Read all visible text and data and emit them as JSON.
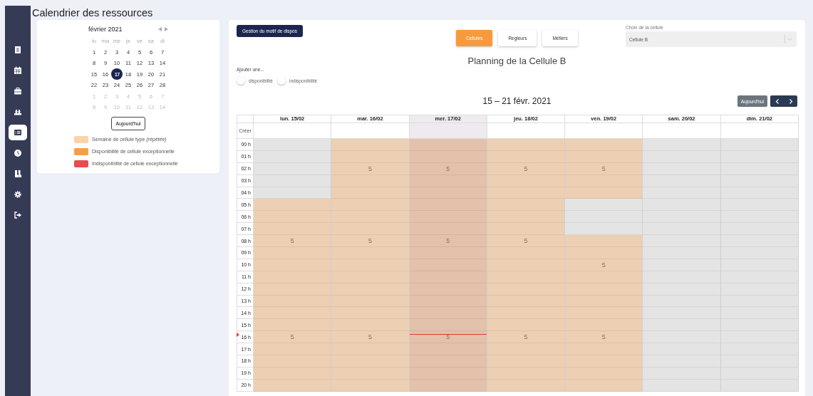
{
  "page_title": "Calendrier des ressources",
  "sidebar": {
    "items": [
      {
        "selected": false
      },
      {
        "selected": false
      },
      {
        "selected": false
      },
      {
        "selected": false
      },
      {
        "selected": true
      },
      {
        "selected": false
      },
      {
        "selected": false
      },
      {
        "selected": false
      },
      {
        "selected": false
      }
    ]
  },
  "mini_calendar": {
    "month": "février 2021",
    "weekdays": [
      "lu",
      "ma",
      "me",
      "je",
      "ve",
      "sa",
      "di"
    ],
    "weeks": [
      [
        {
          "day": "1",
          "outside": false,
          "selected": false
        },
        {
          "day": "2",
          "outside": false,
          "selected": false
        },
        {
          "day": "3",
          "outside": false,
          "selected": false
        },
        {
          "day": "4",
          "outside": false,
          "selected": false
        },
        {
          "day": "5",
          "outside": false,
          "selected": false
        },
        {
          "day": "6",
          "outside": false,
          "selected": false
        },
        {
          "day": "7",
          "outside": false,
          "selected": false
        }
      ],
      [
        {
          "day": "8",
          "outside": false,
          "selected": false
        },
        {
          "day": "9",
          "outside": false,
          "selected": false
        },
        {
          "day": "10",
          "outside": false,
          "selected": false
        },
        {
          "day": "11",
          "outside": false,
          "selected": false
        },
        {
          "day": "12",
          "outside": false,
          "selected": false
        },
        {
          "day": "13",
          "outside": false,
          "selected": false
        },
        {
          "day": "14",
          "outside": false,
          "selected": false
        }
      ],
      [
        {
          "day": "15",
          "outside": false,
          "selected": false
        },
        {
          "day": "16",
          "outside": false,
          "selected": false
        },
        {
          "day": "17",
          "outside": false,
          "selected": true
        },
        {
          "day": "18",
          "outside": false,
          "selected": false
        },
        {
          "day": "19",
          "outside": false,
          "selected": false
        },
        {
          "day": "20",
          "outside": false,
          "selected": false
        },
        {
          "day": "21",
          "outside": false,
          "selected": false
        }
      ],
      [
        {
          "day": "22",
          "outside": false,
          "selected": false
        },
        {
          "day": "23",
          "outside": false,
          "selected": false
        },
        {
          "day": "24",
          "outside": false,
          "selected": false
        },
        {
          "day": "25",
          "outside": false,
          "selected": false
        },
        {
          "day": "26",
          "outside": false,
          "selected": false
        },
        {
          "day": "27",
          "outside": false,
          "selected": false
        },
        {
          "day": "28",
          "outside": false,
          "selected": false
        }
      ],
      [
        {
          "day": "1",
          "outside": true,
          "selected": false
        },
        {
          "day": "2",
          "outside": true,
          "selected": false
        },
        {
          "day": "3",
          "outside": true,
          "selected": false
        },
        {
          "day": "4",
          "outside": true,
          "selected": false
        },
        {
          "day": "5",
          "outside": true,
          "selected": false
        },
        {
          "day": "6",
          "outside": true,
          "selected": false
        },
        {
          "day": "7",
          "outside": true,
          "selected": false
        }
      ],
      [
        {
          "day": "8",
          "outside": true,
          "selected": false
        },
        {
          "day": "9",
          "outside": true,
          "selected": false
        },
        {
          "day": "10",
          "outside": true,
          "selected": false
        },
        {
          "day": "11",
          "outside": true,
          "selected": false
        },
        {
          "day": "12",
          "outside": true,
          "selected": false
        },
        {
          "day": "13",
          "outside": true,
          "selected": false
        },
        {
          "day": "14",
          "outside": true,
          "selected": false
        }
      ]
    ],
    "today_button": "Aujourd'hui"
  },
  "legend": [
    {
      "label": "Semaine de cellule type *(répétée)*",
      "color": "#fdd2a8"
    },
    {
      "label": "Disponibilité de cellule exceptionnelle",
      "color": "#fb9d43"
    },
    {
      "label": "Indisponibilité de cellule exceptionnelle",
      "color": "#e94b4f"
    }
  ],
  "motif_button": "Gestion du motif de dispos",
  "view_tabs": [
    {
      "label": "Cellules",
      "selected": true
    },
    {
      "label": "Regleurs",
      "selected": false
    },
    {
      "label": "Métiers",
      "selected": false
    }
  ],
  "cell_select": {
    "label": "Choix de la cellule",
    "value": "Cellule B"
  },
  "planning_title": "Planning de la Cellule B",
  "add": {
    "label": "Ajouter une...",
    "options": [
      {
        "label": "disponibilité",
        "selected": false
      },
      {
        "label": "indisponibilité",
        "selected": false
      }
    ]
  },
  "range_title": "15 – 21 févr. 2021",
  "today_button": "Aujourd'hui",
  "calendar": {
    "create_label": "Créer",
    "hours": [
      "00 h",
      "01 h",
      "02 h",
      "03 h",
      "04 h",
      "05 h",
      "06 h",
      "07 h",
      "08 h",
      "09 h",
      "10 h",
      "11 h",
      "12 h",
      "13 h",
      "14 h",
      "15 h",
      "16 h",
      "17 h",
      "18 h",
      "19 h",
      "20 h"
    ],
    "days": [
      {
        "label": "lun. 15/02",
        "today": false,
        "slots": [
          {
            "kind": "none"
          },
          {
            "kind": "none"
          },
          {
            "kind": "none"
          },
          {
            "kind": "none"
          },
          {
            "kind": "none"
          },
          {
            "kind": "weekly"
          },
          {
            "kind": "weekly"
          },
          {
            "kind": "weekly"
          },
          {
            "kind": "weekly",
            "label": "5"
          },
          {
            "kind": "weekly"
          },
          {
            "kind": "weekly"
          },
          {
            "kind": "weekly"
          },
          {
            "kind": "weekly"
          },
          {
            "kind": "weekly"
          },
          {
            "kind": "weekly"
          },
          {
            "kind": "weekly"
          },
          {
            "kind": "weekly",
            "label": "5"
          },
          {
            "kind": "weekly"
          },
          {
            "kind": "weekly"
          },
          {
            "kind": "weekly"
          },
          {
            "kind": "weekly"
          }
        ]
      },
      {
        "label": "mar. 16/02",
        "today": false,
        "slots": [
          {
            "kind": "weekly"
          },
          {
            "kind": "weekly"
          },
          {
            "kind": "weekly",
            "label": "5"
          },
          {
            "kind": "weekly"
          },
          {
            "kind": "weekly"
          },
          {
            "kind": "weekly"
          },
          {
            "kind": "weekly"
          },
          {
            "kind": "weekly"
          },
          {
            "kind": "weekly",
            "label": "5"
          },
          {
            "kind": "weekly"
          },
          {
            "kind": "weekly"
          },
          {
            "kind": "weekly"
          },
          {
            "kind": "weekly"
          },
          {
            "kind": "weekly"
          },
          {
            "kind": "weekly"
          },
          {
            "kind": "weekly"
          },
          {
            "kind": "weekly",
            "label": "5"
          },
          {
            "kind": "weekly"
          },
          {
            "kind": "weekly"
          },
          {
            "kind": "weekly"
          },
          {
            "kind": "weekly"
          }
        ]
      },
      {
        "label": "mer. 17/02",
        "today": true,
        "slots": [
          {
            "kind": "weekly"
          },
          {
            "kind": "weekly"
          },
          {
            "kind": "weekly",
            "label": "5"
          },
          {
            "kind": "weekly"
          },
          {
            "kind": "weekly"
          },
          {
            "kind": "weekly"
          },
          {
            "kind": "weekly"
          },
          {
            "kind": "weekly"
          },
          {
            "kind": "weekly",
            "label": "5"
          },
          {
            "kind": "weekly"
          },
          {
            "kind": "weekly"
          },
          {
            "kind": "weekly"
          },
          {
            "kind": "weekly"
          },
          {
            "kind": "weekly"
          },
          {
            "kind": "weekly"
          },
          {
            "kind": "weekly"
          },
          {
            "kind": "weekly",
            "label": "5",
            "now": true
          },
          {
            "kind": "weekly"
          },
          {
            "kind": "weekly"
          },
          {
            "kind": "weekly"
          },
          {
            "kind": "weekly"
          }
        ]
      },
      {
        "label": "jeu. 18/02",
        "today": false,
        "slots": [
          {
            "kind": "weekly"
          },
          {
            "kind": "weekly"
          },
          {
            "kind": "weekly",
            "label": "5"
          },
          {
            "kind": "weekly"
          },
          {
            "kind": "weekly"
          },
          {
            "kind": "weekly"
          },
          {
            "kind": "weekly"
          },
          {
            "kind": "weekly"
          },
          {
            "kind": "weekly",
            "label": "5"
          },
          {
            "kind": "weekly"
          },
          {
            "kind": "weekly"
          },
          {
            "kind": "weekly"
          },
          {
            "kind": "weekly"
          },
          {
            "kind": "weekly"
          },
          {
            "kind": "weekly"
          },
          {
            "kind": "weekly"
          },
          {
            "kind": "weekly",
            "label": "5"
          },
          {
            "kind": "weekly"
          },
          {
            "kind": "weekly"
          },
          {
            "kind": "weekly"
          },
          {
            "kind": "weekly"
          }
        ]
      },
      {
        "label": "ven. 19/02",
        "today": false,
        "slots": [
          {
            "kind": "weekly"
          },
          {
            "kind": "weekly"
          },
          {
            "kind": "weekly",
            "label": "5"
          },
          {
            "kind": "weekly"
          },
          {
            "kind": "weekly"
          },
          {
            "kind": "none"
          },
          {
            "kind": "none"
          },
          {
            "kind": "none"
          },
          {
            "kind": "weekly"
          },
          {
            "kind": "weekly"
          },
          {
            "kind": "weekly",
            "label": "5"
          },
          {
            "kind": "weekly"
          },
          {
            "kind": "weekly"
          },
          {
            "kind": "weekly"
          },
          {
            "kind": "weekly"
          },
          {
            "kind": "weekly"
          },
          {
            "kind": "weekly",
            "label": "5"
          },
          {
            "kind": "weekly"
          },
          {
            "kind": "weekly"
          },
          {
            "kind": "weekly"
          },
          {
            "kind": "weekly"
          }
        ]
      },
      {
        "label": "sam. 20/02",
        "today": false,
        "slots": [
          {
            "kind": "none"
          },
          {
            "kind": "none"
          },
          {
            "kind": "none"
          },
          {
            "kind": "none"
          },
          {
            "kind": "none"
          },
          {
            "kind": "none"
          },
          {
            "kind": "none"
          },
          {
            "kind": "none"
          },
          {
            "kind": "none"
          },
          {
            "kind": "none"
          },
          {
            "kind": "none"
          },
          {
            "kind": "none"
          },
          {
            "kind": "none"
          },
          {
            "kind": "none"
          },
          {
            "kind": "none"
          },
          {
            "kind": "none"
          },
          {
            "kind": "none"
          },
          {
            "kind": "none"
          },
          {
            "kind": "none"
          },
          {
            "kind": "none"
          },
          {
            "kind": "none"
          }
        ]
      },
      {
        "label": "dim. 21/02",
        "today": false,
        "slots": [
          {
            "kind": "none"
          },
          {
            "kind": "none"
          },
          {
            "kind": "none"
          },
          {
            "kind": "none"
          },
          {
            "kind": "none"
          },
          {
            "kind": "none"
          },
          {
            "kind": "none"
          },
          {
            "kind": "none"
          },
          {
            "kind": "none"
          },
          {
            "kind": "none"
          },
          {
            "kind": "none"
          },
          {
            "kind": "none"
          },
          {
            "kind": "none"
          },
          {
            "kind": "none"
          },
          {
            "kind": "none"
          },
          {
            "kind": "none"
          },
          {
            "kind": "none"
          },
          {
            "kind": "none"
          },
          {
            "kind": "none"
          },
          {
            "kind": "none"
          },
          {
            "kind": "none"
          }
        ]
      }
    ]
  }
}
